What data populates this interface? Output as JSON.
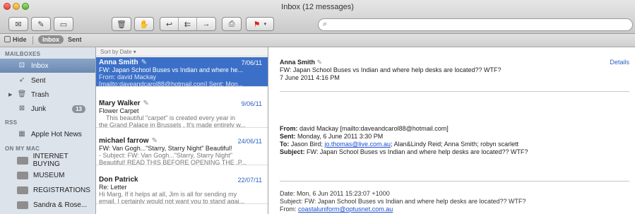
{
  "window": {
    "title": "Inbox (12 messages)"
  },
  "favorites": {
    "hide_label": "Hide",
    "inbox_label": "Inbox",
    "sent_label": "Sent"
  },
  "sidebar": {
    "mailboxes_header": "MAILBOXES",
    "rss_header": "RSS",
    "onmymac_header": "ON MY MAC",
    "inbox": "Inbox",
    "sent": "Sent",
    "trash": "Trash",
    "junk": "Junk",
    "junk_count": "13",
    "rss_item": "Apple Hot News",
    "folders": [
      "INTERNET BUYING",
      "MUSEUM",
      "REGISTRATIONS",
      "Sandra & Rose..."
    ]
  },
  "list": {
    "sort_label": "Sort by Date ▾",
    "messages": [
      {
        "from": "Anna Smith",
        "date": "7/06/11",
        "subject": "FW: Japan School Buses vs Indian and where he...",
        "preview1": "From: david Mackay",
        "preview2": "[mailto:daveandcarol88@hotmail.com] Sent: Mon..."
      },
      {
        "from": "Mary Walker",
        "date": "9/06/11",
        "subject": "Flower Carpet",
        "preview1": "This beautiful \"carpet\" is created every year in",
        "preview2": "the Grand Palace in Brussels . It's made entirely w..."
      },
      {
        "from": "michael farrow",
        "date": "24/06/11",
        "subject": "FW: Van Gogh...\"Starry, Starry Night\" Beautiful!",
        "preview1": "- Subject: FW: Van Gogh...\"Starry, Starry Night\"",
        "preview2": "Beautiful! READ THIS BEFORE OPENING THE .P..."
      },
      {
        "from": "Don Patrick",
        "date": "22/07/11",
        "subject": "Re: Letter",
        "preview1": "Hi Marg, If it helps at all, Jim is all for sending my",
        "preview2": "email. I certainly would not want you to stand agai..."
      }
    ]
  },
  "reader": {
    "sender": "Anna Smith",
    "subject": "FW: Japan School Buses vs Indian and where help desks are located?? WTF?",
    "datetime": "7 June 2011 4:16 PM",
    "details_link": "Details",
    "fwd_from_label": "From:",
    "fwd_from_value": "david Mackay [mailto:daveandcarol88@hotmail.com]",
    "fwd_sent_label": "Sent:",
    "fwd_sent_value": "Monday, 6 June 2011 3:30 PM",
    "fwd_to_label": "To:",
    "fwd_to_pre": "Jason Bird; ",
    "fwd_to_link": "jo.thomas@live.com.au",
    "fwd_to_post": "; Alan&Lindy Reid; Anna Smith; robyn scarlett",
    "fwd_subject_label": "Subject:",
    "fwd_subject_value": "FW: Japan School Buses vs Indian and where help desks are located?? WTF?",
    "raw_date": "Date: Mon, 6 Jun 2011 15:23:07 +1000",
    "raw_subject": "Subject: FW: Japan School Buses vs Indian and where help desks are located?? WTF?",
    "raw_from_label": "From: ",
    "raw_from_link": "coastaluniform@optusnet.com.au"
  }
}
